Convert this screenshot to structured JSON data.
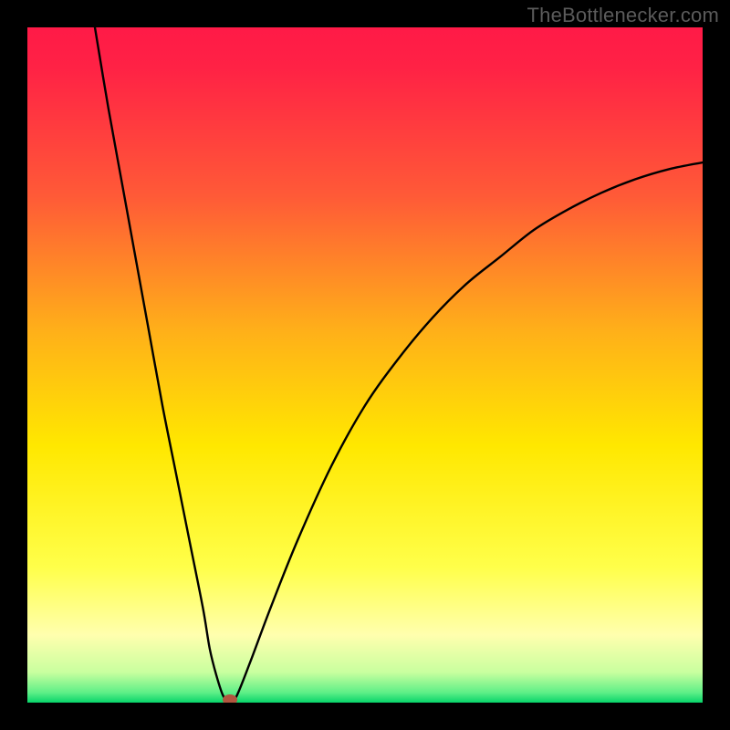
{
  "watermark": "TheBottlenecker.com",
  "chart_data": {
    "type": "line",
    "title": "",
    "xlabel": "",
    "ylabel": "",
    "xlim": [
      0,
      100
    ],
    "ylim": [
      0,
      100
    ],
    "grid": false,
    "series": [
      {
        "name": "bottleneck-curve",
        "x": [
          10,
          12,
          14,
          16,
          18,
          20,
          22,
          24,
          26,
          27,
          28,
          29,
          30,
          31,
          33,
          36,
          40,
          45,
          50,
          55,
          60,
          65,
          70,
          75,
          80,
          85,
          90,
          95,
          100
        ],
        "values": [
          100,
          88,
          77,
          66,
          55,
          44,
          34,
          24,
          14,
          8,
          4,
          1,
          0,
          1,
          6,
          14,
          24,
          35,
          44,
          51,
          57,
          62,
          66,
          70,
          73,
          75.5,
          77.5,
          79,
          80
        ]
      }
    ],
    "marker": {
      "x": 30,
      "y": 0,
      "label": "optimal-point"
    },
    "background_gradient": [
      {
        "pos": 0.0,
        "color": "#ff1a47"
      },
      {
        "pos": 0.06,
        "color": "#ff2245"
      },
      {
        "pos": 0.25,
        "color": "#ff5a37"
      },
      {
        "pos": 0.45,
        "color": "#ffb019"
      },
      {
        "pos": 0.62,
        "color": "#ffe800"
      },
      {
        "pos": 0.8,
        "color": "#ffff4a"
      },
      {
        "pos": 0.9,
        "color": "#ffffae"
      },
      {
        "pos": 0.955,
        "color": "#c9ff9f"
      },
      {
        "pos": 0.985,
        "color": "#5fef87"
      },
      {
        "pos": 1.0,
        "color": "#07d46a"
      }
    ]
  }
}
